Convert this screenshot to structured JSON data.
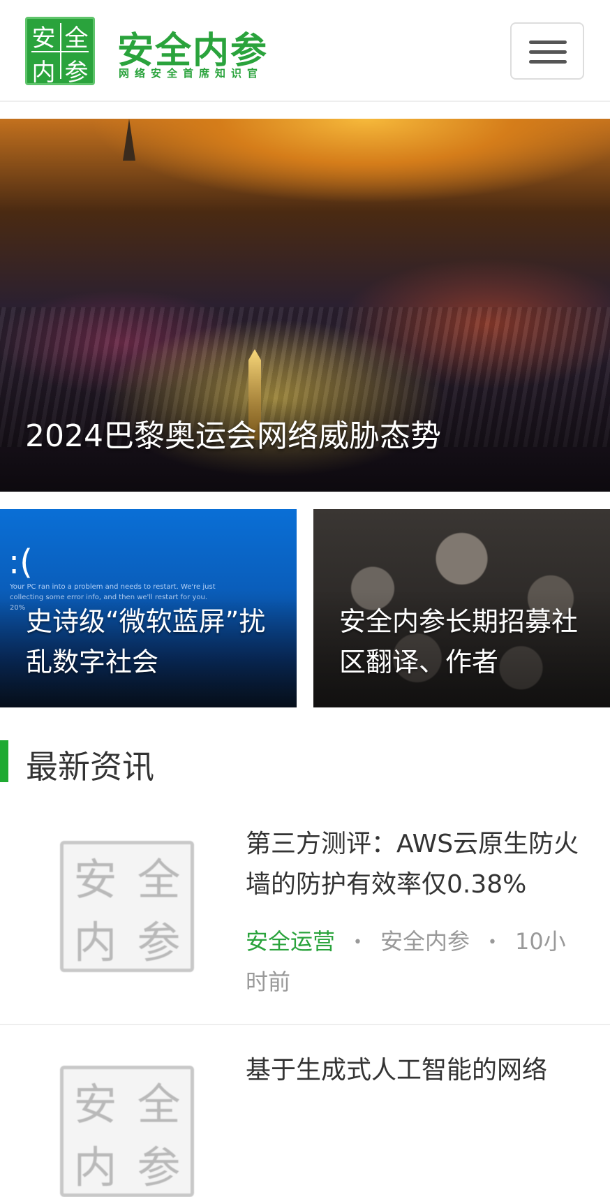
{
  "header": {
    "logo_seal_chars": [
      "安",
      "全",
      "内",
      "参"
    ],
    "brand_name": "安全内参",
    "brand_slogan": "网络安全首席知识官",
    "menu_icon": "hamburger-menu-icon"
  },
  "hero": {
    "title": "2024巴黎奥运会网络威胁态势"
  },
  "cards": [
    {
      "title": "史诗级“微软蓝屏”扰乱数字社会",
      "bsod_face": ":(",
      "bsod_text": "Your PC ran into a problem and needs to restart. We're just collecting some error info, and then we'll restart for you. 20%"
    },
    {
      "title": "安全内参长期招募社区翻译、作者"
    }
  ],
  "section": {
    "title": "最新资讯"
  },
  "articles": [
    {
      "title": "第三方测评：AWS云原生防火墙的防护有效率仅0.38%",
      "category": "安全运营",
      "source": "安全内参",
      "time": "10小时前"
    },
    {
      "title": "基于生成式人工智能的网络"
    }
  ],
  "colors": {
    "brand_green": "#2aa33c",
    "section_bar": "#1faa32"
  }
}
